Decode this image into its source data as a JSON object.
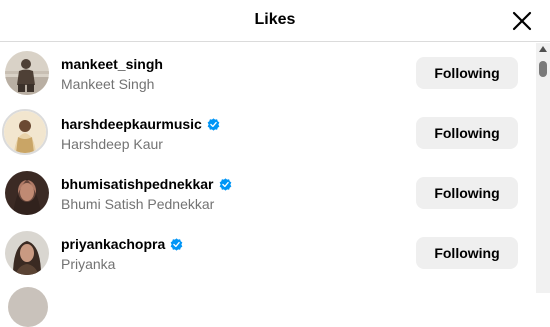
{
  "dialog": {
    "title": "Likes"
  },
  "likes": [
    {
      "username": "mankeet_singh",
      "full_name": "Mankeet Singh",
      "verified": false,
      "button": "Following",
      "avatar_colors": [
        "#d9d2c7",
        "#4e4036"
      ]
    },
    {
      "username": "harshdeepkaurmusic",
      "full_name": "Harshdeep Kaur",
      "verified": true,
      "button": "Following",
      "avatar_colors": [
        "#f2e6cf",
        "#c9a566"
      ]
    },
    {
      "username": "bhumisatishpednekkar",
      "full_name": "Bhumi Satish Pednekkar",
      "verified": true,
      "button": "Following",
      "avatar_colors": [
        "#3b2a24",
        "#b07a66"
      ]
    },
    {
      "username": "priyankachopra",
      "full_name": "Priyanka",
      "verified": true,
      "button": "Following",
      "avatar_colors": [
        "#d9d6d0",
        "#3a2a22"
      ]
    }
  ],
  "colors": {
    "verified_badge": "#0095f6",
    "button_bg": "#efefef",
    "secondary_text": "#737373"
  },
  "icons": {
    "close": "close-icon",
    "verified": "verified-badge-icon"
  }
}
